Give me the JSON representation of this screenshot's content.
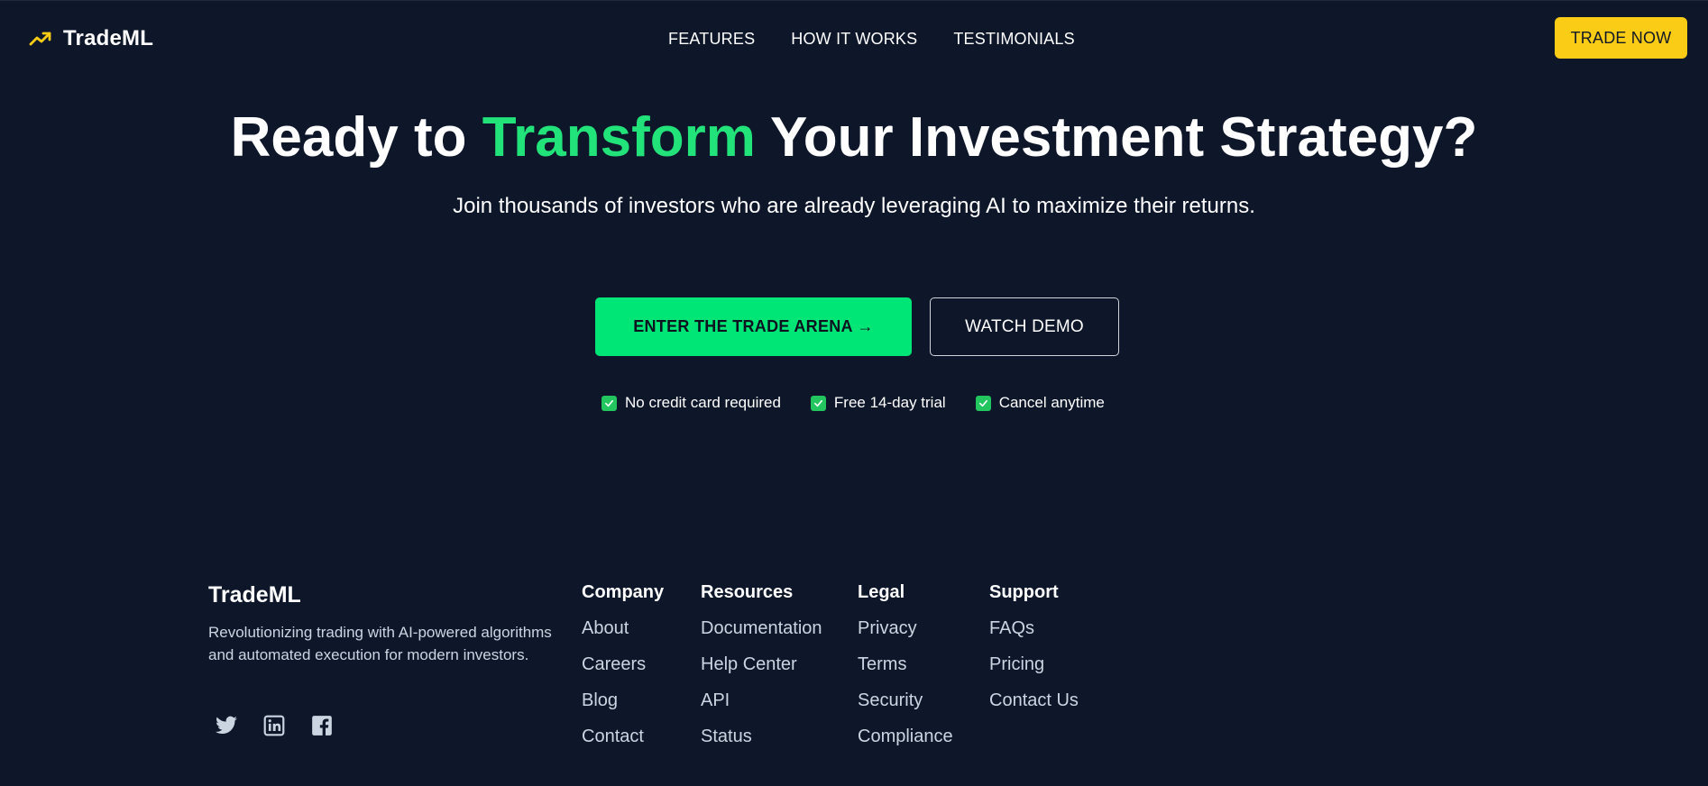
{
  "nav": {
    "brand": "TradeML",
    "brand_icon": "trending-up-icon",
    "links": [
      "FEATURES",
      "HOW IT WORKS",
      "TESTIMONIALS"
    ],
    "cta": "TRADE NOW"
  },
  "hero": {
    "title_before": "Ready to ",
    "title_accent": "Transform",
    "title_after": " Your Investment Strategy?",
    "subtitle": "Join thousands of investors who are already leveraging AI to maximize their returns.",
    "primary_cta": "ENTER THE TRADE ARENA →",
    "secondary_cta": "WATCH DEMO",
    "perks": [
      "No credit card required",
      "Free 14-day trial",
      "Cancel anytime"
    ]
  },
  "footer": {
    "brand": "TradeML",
    "description": "Revolutionizing trading with AI-powered algorithms and automated execution for modern investors.",
    "socials": [
      "twitter-icon",
      "linkedin-icon",
      "facebook-icon"
    ],
    "columns": [
      {
        "title": "Company",
        "links": [
          "About",
          "Careers",
          "Blog",
          "Contact"
        ]
      },
      {
        "title": "Resources",
        "links": [
          "Documentation",
          "Help Center",
          "API",
          "Status"
        ]
      },
      {
        "title": "Legal",
        "links": [
          "Privacy",
          "Terms",
          "Security",
          "Compliance"
        ]
      },
      {
        "title": "Support",
        "links": [
          "FAQs",
          "Pricing",
          "Contact Us"
        ]
      }
    ]
  },
  "colors": {
    "background": "#0e172a",
    "accent_green": "#22e27a",
    "cta_green": "#00e676",
    "brand_yellow": "#facc15"
  }
}
